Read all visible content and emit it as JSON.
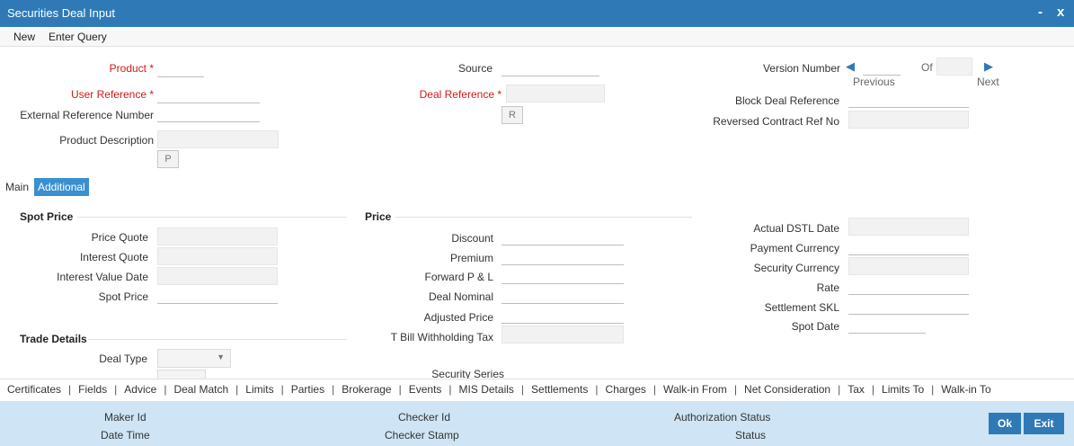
{
  "window": {
    "title": "Securities Deal Input",
    "minimize_glyph": "-",
    "close_glyph": "x"
  },
  "menu": {
    "new": "New",
    "enter_query": "Enter Query"
  },
  "header": {
    "product_label": "Product *",
    "user_reference_label": "User Reference *",
    "external_reference_label": "External Reference Number",
    "product_description_label": "Product Description",
    "p_button": "P",
    "source_label": "Source",
    "deal_reference_label": "Deal Reference *",
    "r_button": "R",
    "version_number_label": "Version Number",
    "of_label": "Of",
    "previous_label": "Previous",
    "next_label": "Next",
    "block_deal_reference_label": "Block Deal Reference",
    "reversed_contract_label": "Reversed Contract Ref No"
  },
  "tabs": {
    "main": "Main",
    "additional": "Additional"
  },
  "spot_price": {
    "heading": "Spot Price",
    "price_quote": "Price Quote",
    "interest_quote": "Interest Quote",
    "interest_value_date": "Interest Value Date",
    "spot_price": "Spot Price"
  },
  "trade_details": {
    "heading": "Trade Details",
    "deal_type": "Deal Type"
  },
  "price": {
    "heading": "Price",
    "discount": "Discount",
    "premium": "Premium",
    "forward_pl": "Forward P & L",
    "deal_nominal": "Deal Nominal",
    "adjusted_price": "Adjusted Price",
    "tbill_tax": "T Bill Withholding Tax",
    "security_series": "Security Series"
  },
  "right_fields": {
    "actual_dstl_date": "Actual DSTL Date",
    "payment_currency": "Payment Currency",
    "security_currency": "Security Currency",
    "rate": "Rate",
    "settlement_skl": "Settlement SKL",
    "spot_date": "Spot Date"
  },
  "subtabs": [
    "Certificates",
    "Fields",
    "Advice",
    "Deal Match",
    "Limits",
    "Parties",
    "Brokerage",
    "Events",
    "MIS Details",
    "Settlements",
    "Charges",
    "Walk-in From",
    "Net Consideration",
    "Tax",
    "Limits To",
    "Walk-in To"
  ],
  "footer": {
    "maker_id": "Maker Id",
    "date_time": "Date Time",
    "checker_id": "Checker Id",
    "checker_stamp": "Checker Stamp",
    "authorization_status": "Authorization Status",
    "status": "Status",
    "ok": "Ok",
    "exit": "Exit"
  },
  "colors": {
    "titlebar": "#2f7ab6",
    "required": "#d01818",
    "footer": "#cfe5f5",
    "active_tab": "#3a8fd1"
  }
}
